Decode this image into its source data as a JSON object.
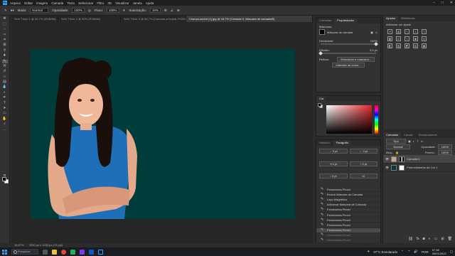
{
  "app": {
    "logo": "Ps"
  },
  "menu": [
    "Arquivo",
    "Editar",
    "Imagem",
    "Camada",
    "Texto",
    "Selecionar",
    "Filtro",
    "3D",
    "Visualizar",
    "Janela",
    "Ajuda"
  ],
  "window_controls": {
    "minimize": "–",
    "maximize": "□",
    "close": "✕"
  },
  "options": {
    "mode_label": "Modo:",
    "mode_value": "Normal",
    "opacity_label": "Opacidade:",
    "opacity_value": "100%",
    "flow_label": "Fluxo:",
    "flow_value": "100%",
    "smoothing_label": "Suavização:",
    "smoothing_value": "10%"
  },
  "tabs": [
    "Sem Título-1 @ 66,7% (RGB/8#)",
    "Sem Título-2 @ 50% (RGB/8#)",
    "Sem Título-3 @ 66,7% (Camada principal, RGB/8#)",
    "Crianca-sorind (1).jpg @ 16,7% (Camada 0, Máscara de camada/8)"
  ],
  "status": {
    "zoom": "16,67%",
    "doc": "2000 px x 1333 px (72 ppi)"
  },
  "properties": {
    "tabs": [
      "Camadas",
      "Propriedades"
    ],
    "title": "Máscaras",
    "mask_label": "Máscara de camada",
    "density_label": "Densidade:",
    "density_value": "100%",
    "feather_label": "Difusão:",
    "feather_value": "0,0 px",
    "refine_label": "Refinar:",
    "select_mask_btn": "Selecionar e mascarar...",
    "color_range_btn": "Intervalo de cores...",
    "density_level": 1.0,
    "feather_level": 0.0
  },
  "color": {
    "tabs": [
      "Cor"
    ],
    "accent": "#e0262b"
  },
  "history": {
    "tabs": [
      "Histórico",
      "Parágrafo"
    ],
    "items": [
      {
        "label": "Ferramenta Pincel",
        "state": "normal"
      },
      {
        "label": "Excluir Máscara de Camada",
        "state": "normal"
      },
      {
        "label": "Laço Magnético",
        "state": "normal"
      },
      {
        "label": "Adicionar Máscara de Camada",
        "state": "normal"
      },
      {
        "label": "Ferramenta Pincel",
        "state": "normal"
      },
      {
        "label": "Ferramenta Pincel",
        "state": "normal"
      },
      {
        "label": "Ferramenta Pincel",
        "state": "normal"
      },
      {
        "label": "Ferramenta Pincel",
        "state": "normal"
      },
      {
        "label": "Ferramenta Pincel",
        "state": "selected"
      },
      {
        "label": "Ferramenta Pincel",
        "state": "dim"
      },
      {
        "label": "Ferramenta Pincel",
        "state": "dim"
      }
    ]
  },
  "adjustments": {
    "tabs": [
      "Ajustes",
      "Bibliotecas"
    ],
    "subtitle": "Adicionar um ajuste"
  },
  "layers": {
    "tabs": [
      "Camadas",
      "Canais",
      "Demarcadores"
    ],
    "filter_label": "Tipo",
    "blend_mode": "Normal",
    "opacity_label": "Opacidade:",
    "opacity_value": "100%",
    "lock_label": "Bloq.:",
    "fill_label": "Preenc.:",
    "fill_value": "100%",
    "rows": [
      {
        "name": "Camada 0",
        "selected": true
      },
      {
        "name": "Preenchimento de Cor 1",
        "selected": false
      }
    ]
  },
  "taskbar": {
    "search_placeholder": "Pesquisar",
    "weather": "37°C Ensolarado",
    "language": "POR",
    "time": "07:38",
    "date": "05/01/2022"
  },
  "colors": {
    "canvas_bg": "#003c3a",
    "ps_blue": "#31a8ff"
  }
}
